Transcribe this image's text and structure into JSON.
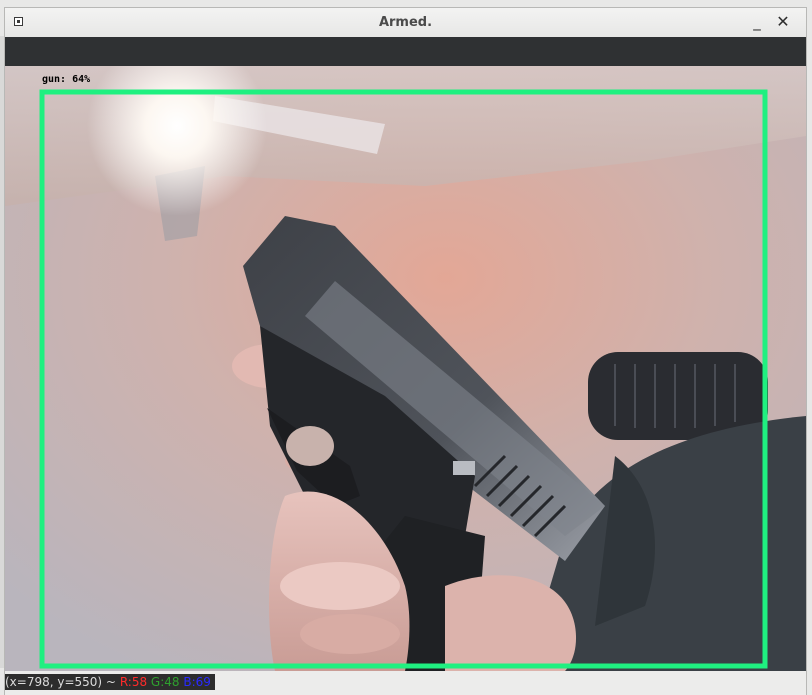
{
  "window": {
    "title": "Armed.",
    "minimize_glyph": "_",
    "close_glyph": "✕",
    "icon": "window-menu-icon"
  },
  "detection": {
    "label": "gun:",
    "confidence": "64%",
    "box_color": "#1ff080"
  },
  "status": {
    "coords": "(x=798, y=550) ~",
    "r": "R:58",
    "g": "G:48",
    "b": "B:69"
  },
  "colors": {
    "box": "#1ff080",
    "toolbar": "#2f3133"
  }
}
